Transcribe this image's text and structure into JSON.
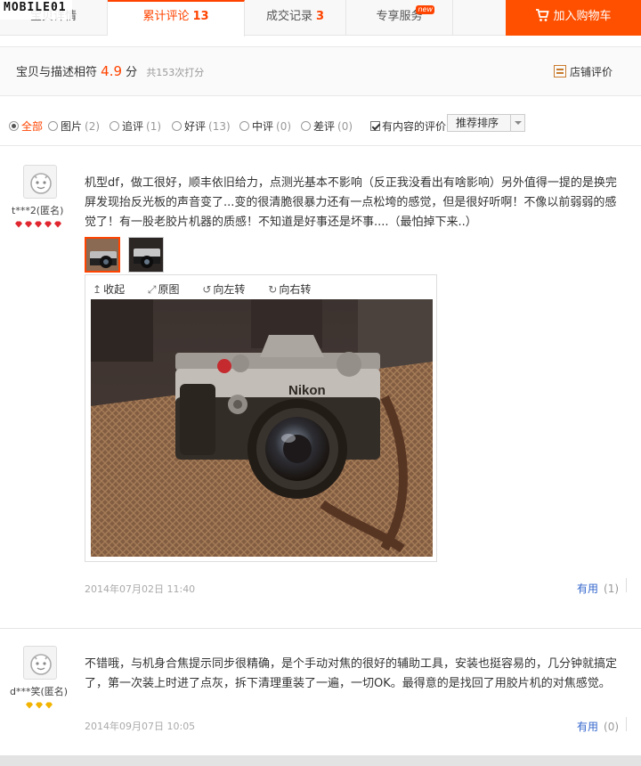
{
  "watermark": "MOBILE01",
  "tabs": {
    "details": "宝贝详情",
    "reviews_label": "累计评论",
    "reviews_count": "13",
    "deals_label": "成交记录",
    "deals_count": "3",
    "vip_label": "专享服务",
    "vip_badge": "new",
    "cart_label": "加入购物车"
  },
  "summary": {
    "label": "宝贝与描述相符",
    "score": "4.9",
    "unit": "分",
    "count_text": "共153次打分",
    "shop_rating": "店铺评价"
  },
  "filters": {
    "all": "全部",
    "pic": "图片",
    "pic_count": "(2)",
    "append": "追评",
    "append_count": "(1)",
    "good": "好评",
    "good_count": "(13)",
    "mid": "中评",
    "mid_count": "(0)",
    "bad": "差评",
    "bad_count": "(0)",
    "content_only": "有内容的评价",
    "sort": "推荐排序"
  },
  "reviews": [
    {
      "user": "t***2(匿名)",
      "text": "机型df，做工很好，顺丰依旧给力，点测光基本不影响（反正我没看出有啥影响）另外值得一提的是换完屏发现抬反光板的声音变了...变的很清脆很暴力还有一点松垮的感觉，但是很好听啊！不像以前弱弱的感觉了！有一股老胶片机器的质感！不知道是好事还是坏事....（最怕掉下来..）",
      "tools": {
        "collapse": "收起",
        "original": "原图",
        "rotate_left": "向左转",
        "rotate_right": "向右转"
      },
      "date": "2014年07月02日 11:40",
      "useful": "有用",
      "useful_count": "(1)",
      "rank_color": "#e0262f"
    },
    {
      "user": "d***笑(匿名)",
      "text": "不错哦，与机身合焦提示同步很精确，是个手动对焦的很好的辅助工具，安装也挺容易的，几分钟就搞定了，第一次装上时进了点灰，拆下清理重装了一遍，一切OK。最得意的是找回了用胶片机的对焦感觉。",
      "date": "2014年09月07日 10:05",
      "useful": "有用",
      "useful_count": "(0)",
      "rank_color": "#f2b400"
    }
  ],
  "photo_brand": "Nikon"
}
